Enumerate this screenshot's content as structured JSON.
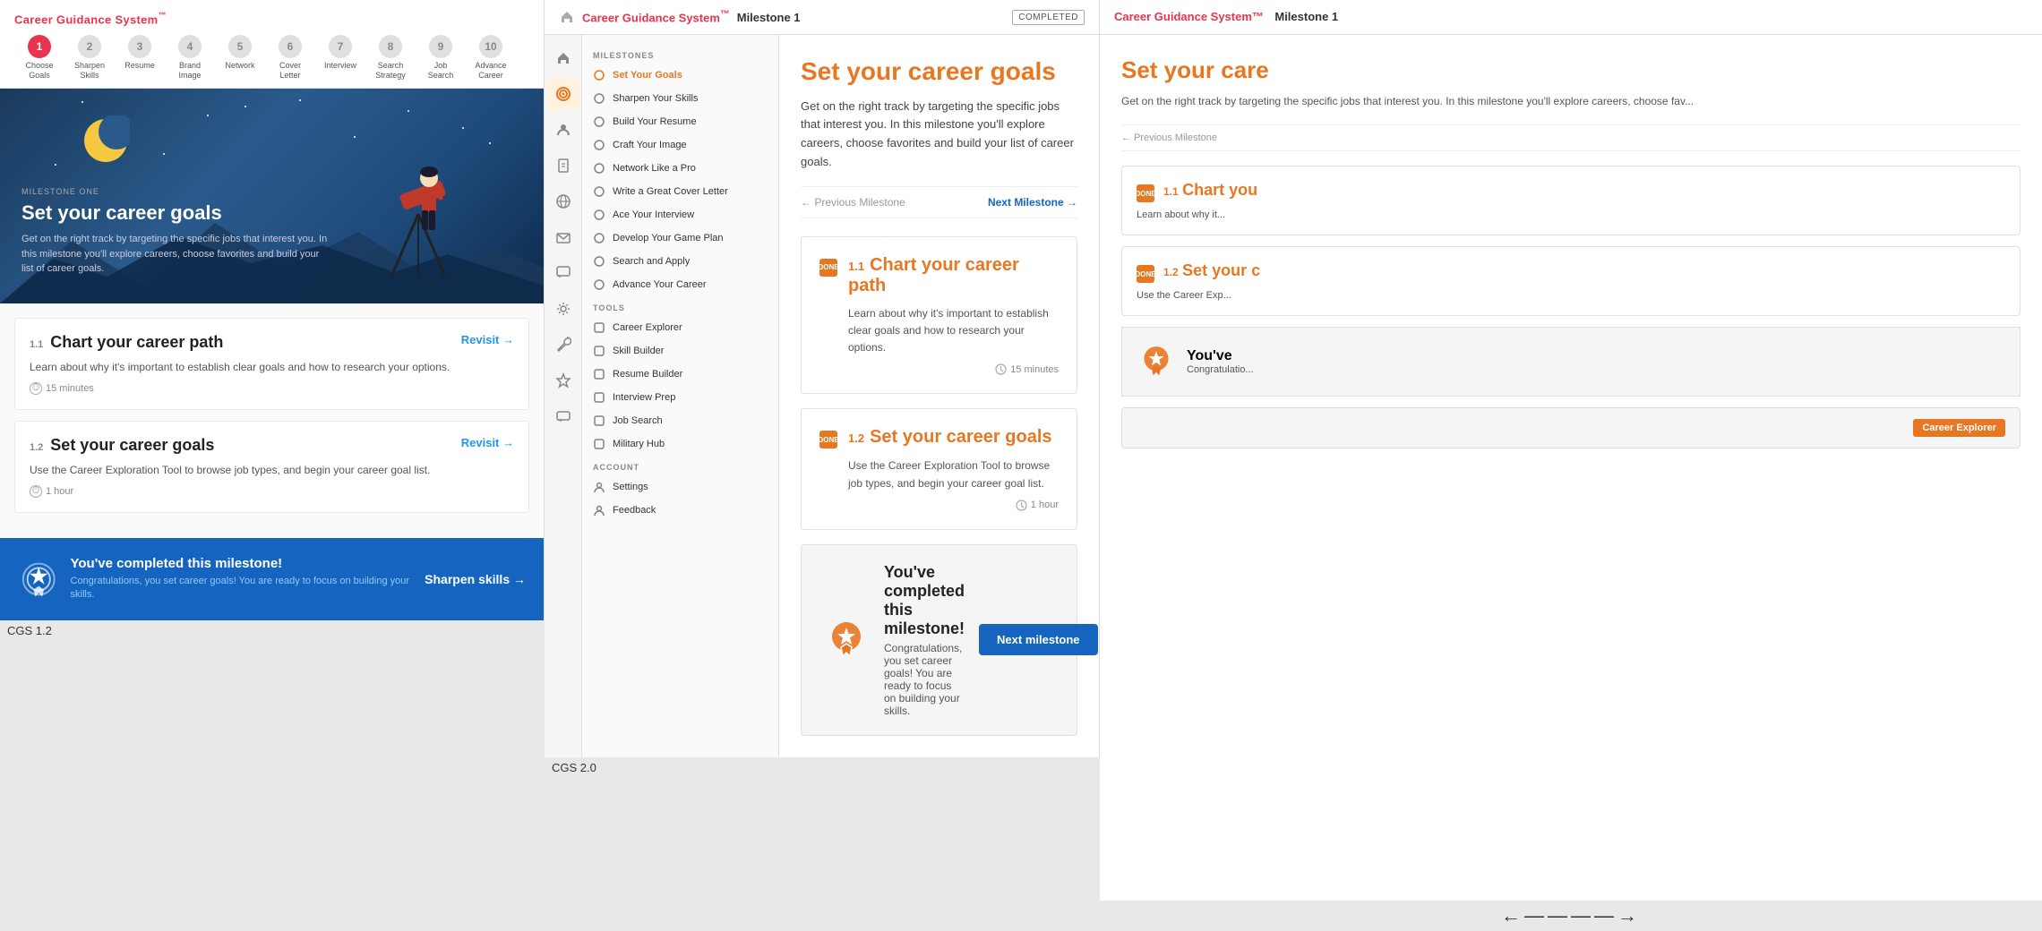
{
  "brand": {
    "name": "Career Guidance System",
    "tm": "™"
  },
  "panel1": {
    "label": "CGS 1.2",
    "steps": [
      {
        "number": "1",
        "label": "Choose\nGoals",
        "active": true
      },
      {
        "number": "2",
        "label": "Sharpen\nSkills",
        "active": false
      },
      {
        "number": "3",
        "label": "Resume",
        "active": false
      },
      {
        "number": "4",
        "label": "Brand\nImage",
        "active": false
      },
      {
        "number": "5",
        "label": "Network",
        "active": false
      },
      {
        "number": "6",
        "label": "Cover\nLetter",
        "active": false
      },
      {
        "number": "7",
        "label": "Interview",
        "active": false
      },
      {
        "number": "8",
        "label": "Search\nStrategy",
        "active": false
      },
      {
        "number": "9",
        "label": "Job\nSearch",
        "active": false
      },
      {
        "number": "10",
        "label": "Advance\nCareer",
        "active": false
      }
    ],
    "hero": {
      "milestone_label": "MILESTONE ONE",
      "title": "Set your career goals",
      "description": "Get on the right track by targeting the specific jobs that interest you. In this milestone you'll explore careers, choose favorites and build your list of career goals."
    },
    "lessons": [
      {
        "number": "1.1",
        "title": "Chart your career path",
        "description": "Learn about why it's important to establish clear goals and how to research your options.",
        "time": "15 minutes",
        "action": "Revisit"
      },
      {
        "number": "1.2",
        "title": "Set your career goals",
        "description": "Use the Career Exploration Tool to browse job types, and begin your career goal list.",
        "time": "1 hour",
        "action": "Revisit"
      }
    ],
    "footer": {
      "title": "You've completed this milestone!",
      "description": "Congratulations, you set career goals! You are ready to focus on building your skills.",
      "action": "Sharpen skills →"
    }
  },
  "panel2": {
    "label": "CGS 2.0",
    "milestone_label": "Milestone 1",
    "completed": "COMPLETED",
    "page_title": "Set your career goals",
    "page_description": "Get on the right track by targeting the specific jobs that interest you. In this milestone you'll explore careers, choose favorites and build your list of career goals.",
    "prev_milestone": "← Previous Milestone",
    "next_milestone": "Next Milestone →",
    "lessons": [
      {
        "number": "1.1",
        "title": "Chart your career path",
        "description": "Learn about why it's important to establish clear goals and how to research your options.",
        "time": "15 minutes",
        "done": true
      },
      {
        "number": "1.2",
        "title": "Set your career goals",
        "description": "Use the Career Exploration Tool to browse job types, and begin your career goal list.",
        "time": "1 hour",
        "done": true
      }
    ],
    "completion": {
      "title": "You've completed this milestone!",
      "description": "Congratulations, you set career goals! You are ready to focus on building your skills.",
      "button": "Next milestone"
    },
    "sidebar": {
      "milestones_label": "MILESTONES",
      "milestones": [
        {
          "label": "Set Your Goals",
          "active": true
        },
        {
          "label": "Sharpen Your Skills",
          "active": false
        },
        {
          "label": "Build Your Resume",
          "active": false
        },
        {
          "label": "Craft Your Image",
          "active": false
        },
        {
          "label": "Network Like a Pro",
          "active": false
        },
        {
          "label": "Write a Great Cover Letter",
          "active": false
        },
        {
          "label": "Ace Your Interview",
          "active": false
        },
        {
          "label": "Develop Your Game Plan",
          "active": false
        },
        {
          "label": "Search and Apply",
          "active": false
        },
        {
          "label": "Advance Your Career",
          "active": false
        }
      ],
      "tools_label": "TOOLS",
      "tools": [
        {
          "label": "Career Explorer",
          "active": false
        },
        {
          "label": "Skill Builder",
          "active": false
        },
        {
          "label": "Resume Builder",
          "active": false
        },
        {
          "label": "Interview Prep",
          "active": false
        },
        {
          "label": "Job Search",
          "active": false
        },
        {
          "label": "Military Hub",
          "active": false
        }
      ],
      "account_label": "ACCOUNT",
      "account": [
        {
          "label": "Settings",
          "active": false
        },
        {
          "label": "Feedback",
          "active": false
        }
      ]
    }
  },
  "panel3": {
    "brand_text": "Career Guidance System™",
    "milestone_label": "Milestone 1",
    "page_title": "Set your care",
    "page_description": "Get on the right track by targeting the specific jobs that interest you. In this milestone you'll explore careers, choose fav...",
    "prev_milestone": "← Previous Milestone",
    "lessons": [
      {
        "number": "1.1",
        "title": "Chart you",
        "description": "Learn about why it...",
        "done": true
      },
      {
        "number": "1.2",
        "title": "Set your c",
        "description": "Use the Career Exp...",
        "done": true
      }
    ],
    "completion": {
      "title": "You've",
      "description": "Congratulatio..."
    },
    "career_explorer_tag": "Career Explorer"
  },
  "arrow": "←————→",
  "bottom_label1": "CGS 1.2",
  "bottom_label2": "CGS 2.0"
}
